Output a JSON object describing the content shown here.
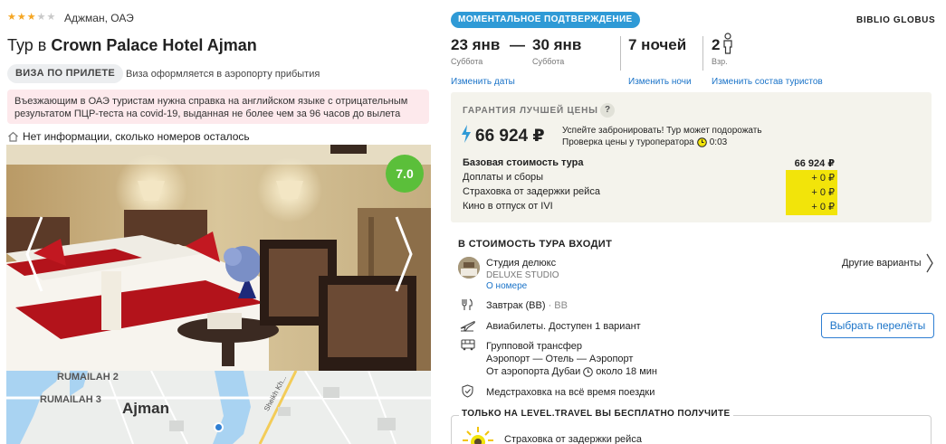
{
  "hotel": {
    "stars": 3,
    "max_stars": 5,
    "location": "Аджман, ОАЭ",
    "title_prefix": "Тур в",
    "name": "Crown Palace Hotel Ajman",
    "visa_badge": "ВИЗА ПО ПРИЛЕТЕ",
    "visa_note": "Виза оформляется в аэропорту прибытия",
    "alert": "Въезжающим в ОАЭ туристам нужна справка на английском языке с отрицательным результатом ПЦР-теста на covid-19, выданная не более чем за 96 часов до вылета",
    "rooms_info": "Нет информации, сколько номеров осталось",
    "rating": "7.0"
  },
  "map": {
    "labels": [
      "RUMAILAH 2",
      "RUMAILAH 3",
      "Ajman"
    ],
    "road_label": "Sheikh Kh..."
  },
  "booking": {
    "instant_badge": "МОМЕНТАЛЬНОЕ ПОДТВЕРЖДЕНИЕ",
    "operator": "BIBLIO GLOBUS",
    "date_from": "23 янв",
    "date_dash": "—",
    "date_to": "30 янв",
    "day_from": "Суббота",
    "day_to": "Суббота",
    "nights": "7 ночей",
    "adults": "2",
    "adults_label": "Взр.",
    "change_dates": "Изменить даты",
    "change_nights": "Изменить ночи",
    "change_tourists": "Изменить состав туристов"
  },
  "price": {
    "guarantee": "ГАРАНТИЯ ЛУЧШЕЙ ЦЕНЫ",
    "help": "?",
    "total": "66 924 ₽",
    "hurry_line1": "Успейте забронировать! Тур может подорожать",
    "hurry_line2": "Проверка цены у туроператора",
    "timer": "0:03",
    "lines": [
      {
        "label": "Базовая стоимость тура",
        "value": "66 924 ₽",
        "bold": true
      },
      {
        "label": "Доплаты и сборы",
        "value": "+ 0 ₽",
        "bold": false
      },
      {
        "label": "Страховка от задержки рейса",
        "value": "+ 0 ₽",
        "bold": false
      },
      {
        "label": "Кино в отпуск от IVI",
        "value": "+ 0 ₽",
        "bold": false
      }
    ],
    "highlight_color": "#f2e40a"
  },
  "included": {
    "title": "В СТОИМОСТЬ ТУРА ВХОДИТ",
    "room_name": "Студия делюкс",
    "room_code": "DELUXE STUDIO",
    "room_link": "О номере",
    "other_options": "Другие варианты",
    "meal": "Завтрак (BB)",
    "meal_code": "· BB",
    "flights": "Авиабилеты. Доступен 1 вариант",
    "choose_flights": "Выбрать перелёты",
    "transfer_title": "Групповой трансфер",
    "transfer_route": "Аэропорт — Отель — Аэропорт",
    "transfer_from": "От аэропорта Дубаи",
    "transfer_time": "около 18 мин",
    "insurance": "Медстраховка на всё время поездки"
  },
  "free": {
    "title": "ТОЛЬКО НА LEVEL.TRAVEL ВЫ БЕСПЛАТНО ПОЛУЧИТЕ",
    "item": "Страховка от задержки рейса"
  },
  "colors": {
    "accent": "#2f9ad6",
    "link": "#1a73c8",
    "rating": "#5bbf3a",
    "alert_bg": "#fde9ec",
    "star": "#f5a623"
  }
}
